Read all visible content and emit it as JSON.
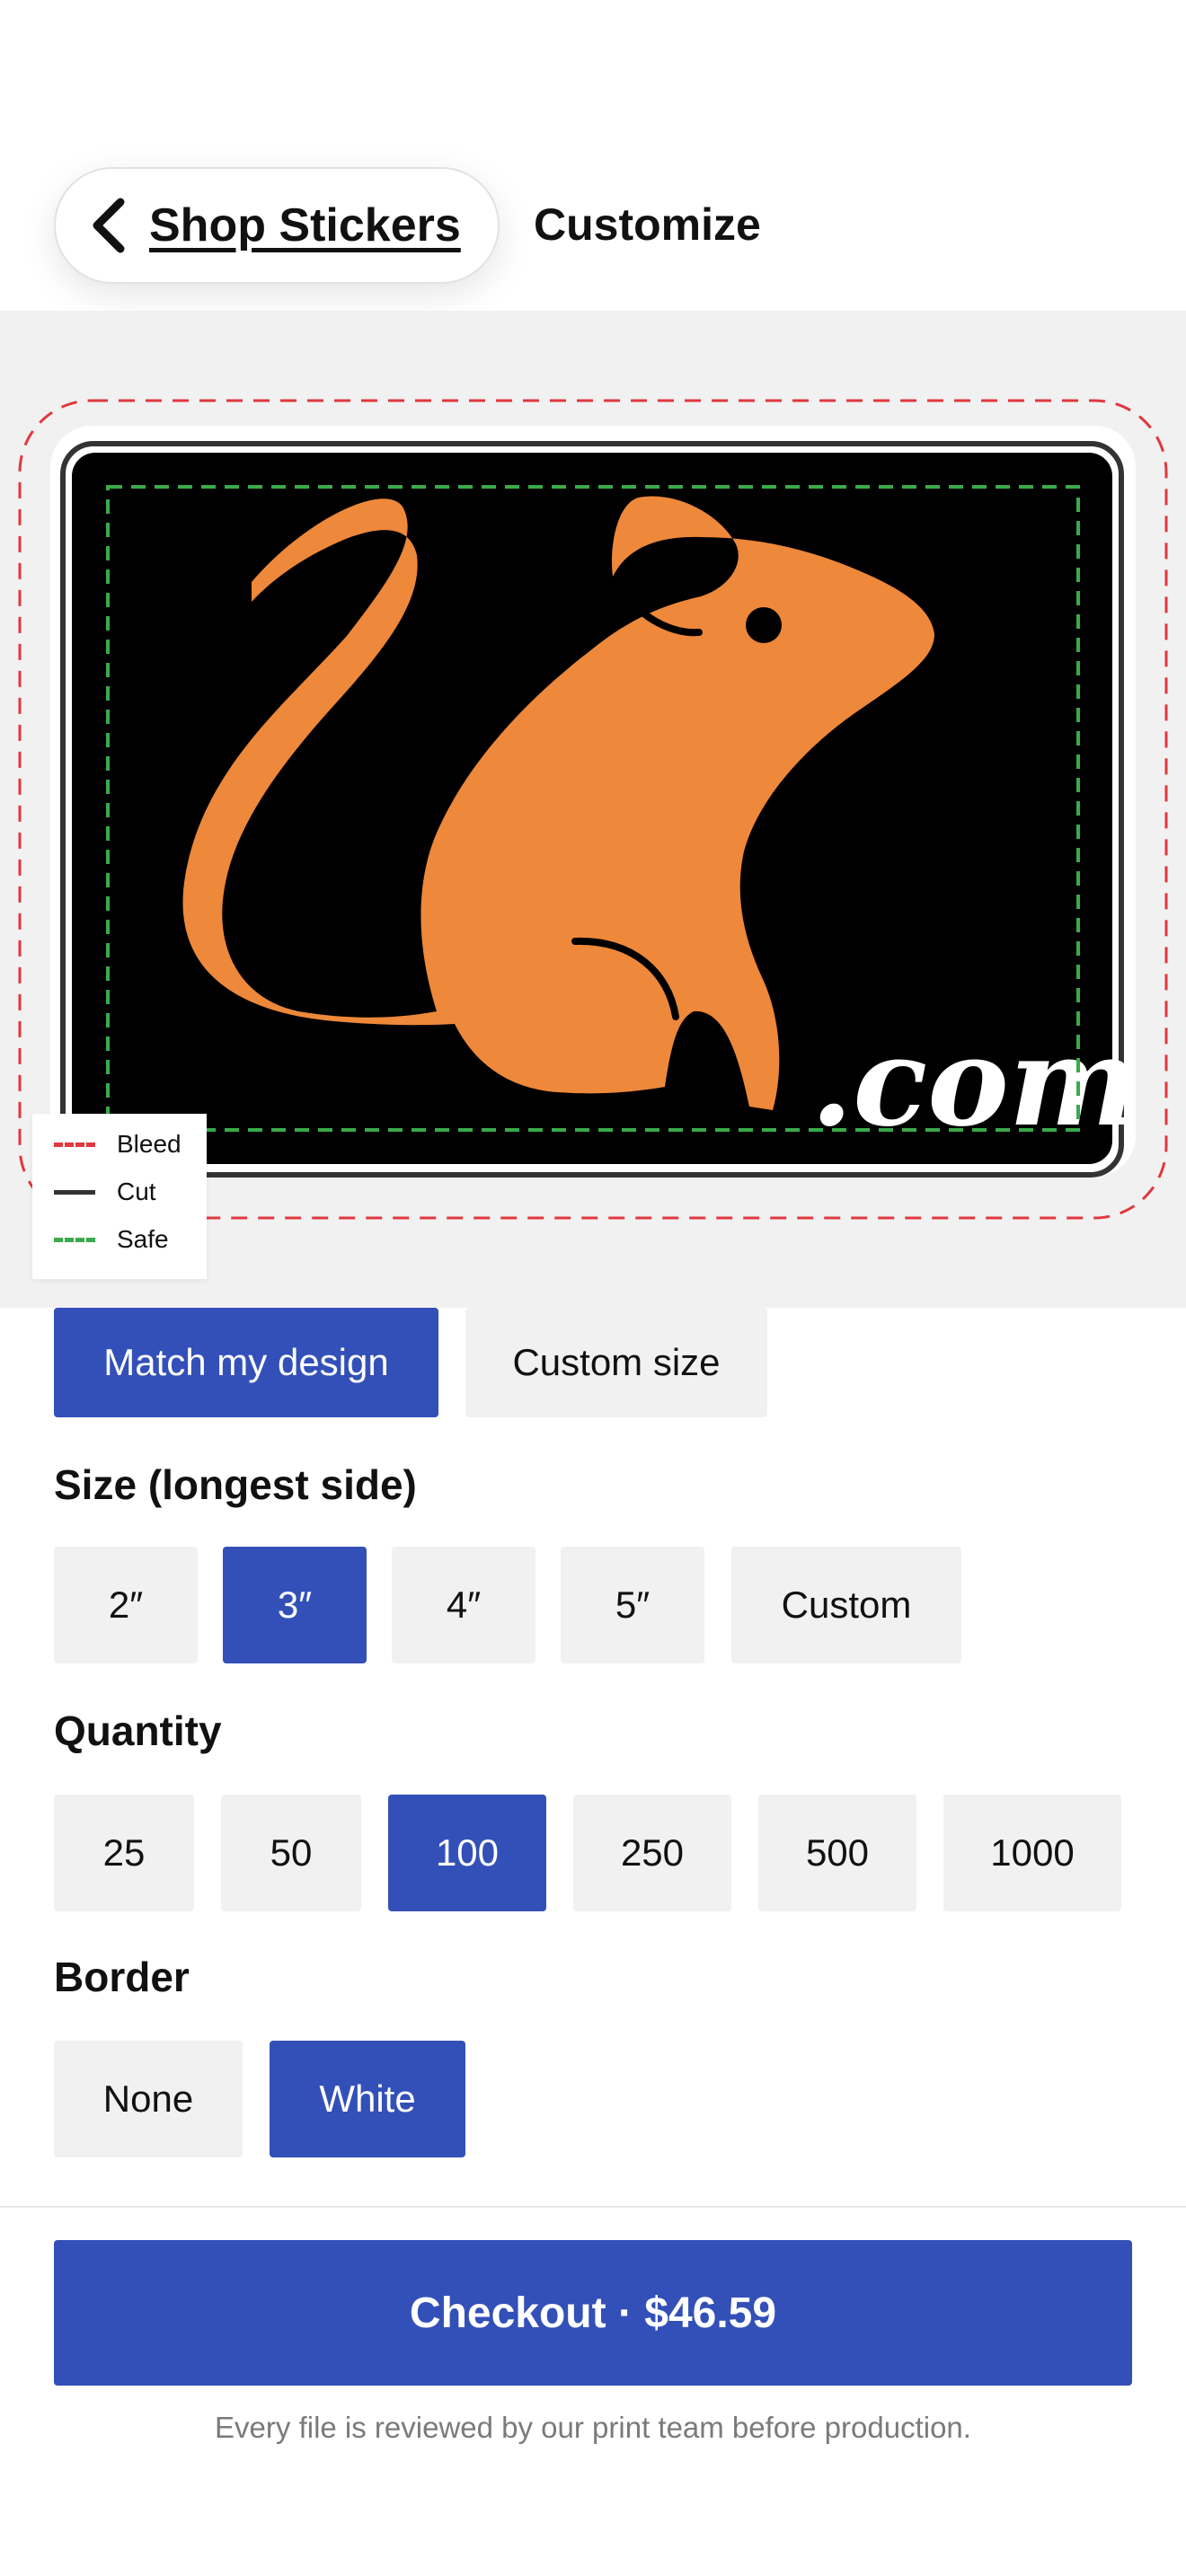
{
  "header": {
    "back_label": "Shop Stickers",
    "title": "Customize"
  },
  "preview": {
    "domain_text": ".com",
    "legend": {
      "bleed": "Bleed",
      "cut": "Cut",
      "safe": "Safe"
    },
    "colors": {
      "bleed": "#e0383e",
      "cut": "#333333",
      "safe": "#3aaa4a",
      "sticker_bg": "#000000",
      "mouse": "#ee883a"
    }
  },
  "shape_options": {
    "items": [
      {
        "label": "Match my design",
        "selected": true
      },
      {
        "label": "Custom size",
        "selected": false
      }
    ]
  },
  "size": {
    "label": "Size (longest side)",
    "options": [
      {
        "label": "2″",
        "selected": false
      },
      {
        "label": "3″",
        "selected": true
      },
      {
        "label": "4″",
        "selected": false
      },
      {
        "label": "5″",
        "selected": false
      },
      {
        "label": "Custom",
        "selected": false
      }
    ]
  },
  "quantity": {
    "label": "Quantity",
    "options": [
      {
        "label": "25",
        "selected": false
      },
      {
        "label": "50",
        "selected": false
      },
      {
        "label": "100",
        "selected": true
      },
      {
        "label": "250",
        "selected": false
      },
      {
        "label": "500",
        "selected": false
      },
      {
        "label": "1000",
        "selected": false
      }
    ]
  },
  "border": {
    "label": "Border",
    "options": [
      {
        "label": "None",
        "selected": false
      },
      {
        "label": "White",
        "selected": true
      }
    ]
  },
  "checkout": {
    "label": "Checkout · $46.59",
    "note": "Every file is reviewed by our print team before production."
  },
  "accent_color": "#3350b8"
}
